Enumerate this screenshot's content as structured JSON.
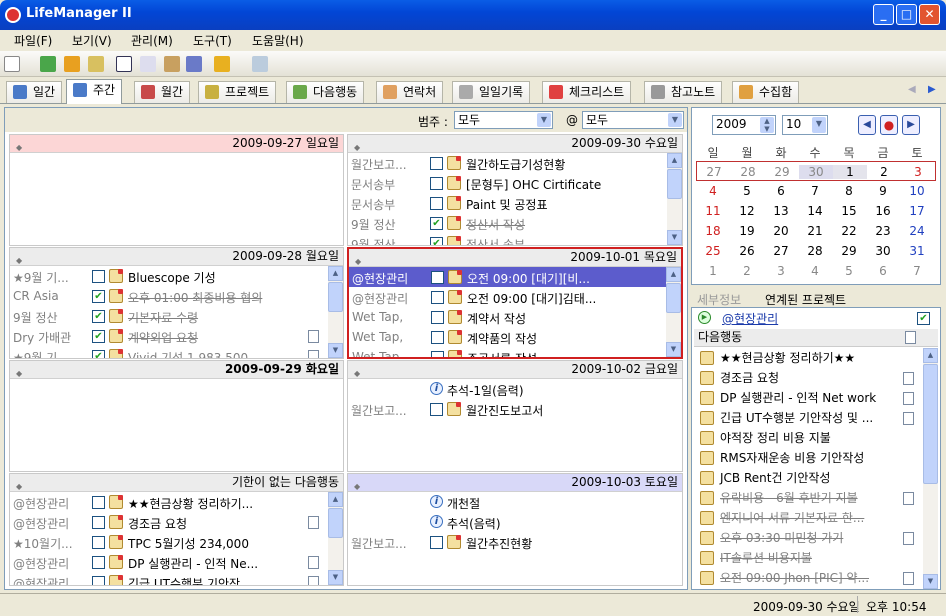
{
  "app": {
    "title": "LifeManager II"
  },
  "menu": [
    "파일(F)",
    "보기(V)",
    "관리(M)",
    "도구(T)",
    "도움말(H)"
  ],
  "tabs": [
    "일간",
    "주간",
    "월간",
    "프로젝트",
    "다음행동",
    "연락처",
    "일일기록",
    "체크리스트",
    "참고노트",
    "수집함"
  ],
  "filter": {
    "label": "범주 :",
    "category": "모두",
    "at": "@",
    "context": "모두"
  },
  "days": {
    "d0927": {
      "title": "2009-09-27 일요일"
    },
    "d0928": {
      "title": "2009-09-28 월요일",
      "items": [
        {
          "cat": "★9월 기...",
          "text": "Bluescope 기성",
          "done": false
        },
        {
          "cat": "CR Asia",
          "text": "오후 01:00 최종비용 협의",
          "done": true
        },
        {
          "cat": "9월 정산",
          "text": "기본자료 수령",
          "done": true
        },
        {
          "cat": "Dry 가배관",
          "text": "계약외업 요청",
          "done": true
        },
        {
          "cat": "★9월 기",
          "text": "Vivid 기성 1,983,500",
          "done": true
        }
      ]
    },
    "d0929": {
      "title": "2009-09-29 화요일"
    },
    "d0930": {
      "title": "2009-09-30 수요일",
      "items": [
        {
          "cat": "월간보고...",
          "text": "월간하도급기성현황",
          "done": false
        },
        {
          "cat": "문서송부",
          "text": "[문형두] OHC Cirtificate",
          "done": false
        },
        {
          "cat": "문서송부",
          "text": "Paint 및 공정표",
          "done": false
        },
        {
          "cat": "9월 정산",
          "text": "정산서 작성",
          "done": true
        },
        {
          "cat": "9월 정산",
          "text": "정산서 송부",
          "done": true
        }
      ]
    },
    "d1001": {
      "title": "2009-10-01 목요일",
      "items": [
        {
          "cat": "@현장관리",
          "text": "오전 09:00 [대기][비...",
          "done": false
        },
        {
          "cat": "@현장관리",
          "text": "오전 09:00 [대기]김태...",
          "done": false
        },
        {
          "cat": "Wet Tap,",
          "text": "계약서 작성",
          "done": false
        },
        {
          "cat": "Wet Tap,",
          "text": "계약품의 작성",
          "done": false
        },
        {
          "cat": "Wet Tap",
          "text": "주공서류 작성",
          "done": false
        }
      ]
    },
    "d1002": {
      "title": "2009-10-02 금요일",
      "info": "추석-1일(음력)",
      "items": [
        {
          "cat": "월간보고...",
          "text": "월간진도보고서",
          "done": false
        }
      ]
    },
    "d1003": {
      "title": "2009-10-03 토요일",
      "info1": "개천절",
      "info2": "추석(음력)",
      "items": [
        {
          "cat": "월간보고...",
          "text": "월간추진현황",
          "done": false
        }
      ]
    },
    "nodate": {
      "title": "기한이 없는 다음행동",
      "items": [
        {
          "cat": "@현장관리",
          "text": "★★현금상황 정리하기..."
        },
        {
          "cat": "@현장관리",
          "text": "경조금 요청"
        },
        {
          "cat": "★10월기...",
          "text": "TPC 5월기성 234,000"
        },
        {
          "cat": "@현장관리",
          "text": "DP 실행관리 - 인적 Ne..."
        },
        {
          "cat": "@현장관리",
          "text": "긴급 UT수행분 기안작..."
        }
      ]
    }
  },
  "calendar": {
    "year": "2009",
    "month": "10",
    "weekdays": [
      "일",
      "월",
      "화",
      "수",
      "목",
      "금",
      "토"
    ],
    "weeks": [
      [
        "27",
        "28",
        "29",
        "30",
        "1",
        "2",
        "3"
      ],
      [
        "4",
        "5",
        "6",
        "7",
        "8",
        "9",
        "10"
      ],
      [
        "11",
        "12",
        "13",
        "14",
        "15",
        "16",
        "17"
      ],
      [
        "18",
        "19",
        "20",
        "21",
        "22",
        "23",
        "24"
      ],
      [
        "25",
        "26",
        "27",
        "28",
        "29",
        "30",
        "31"
      ],
      [
        "1",
        "2",
        "3",
        "4",
        "5",
        "6",
        "7"
      ]
    ]
  },
  "right_tabs": [
    "세부정보",
    "연계된 프로젝트"
  ],
  "project": {
    "name": "@현장관리",
    "list_header": "다음행동",
    "items": [
      {
        "text": "★★현금상황 정리하기★★",
        "done": false
      },
      {
        "text": "경조금 요청",
        "done": false
      },
      {
        "text": "DP 실행관리 - 인적 Net work",
        "done": false
      },
      {
        "text": "긴급 UT수행분 기안작성 및 ...",
        "done": false
      },
      {
        "text": "야적장 정리 비용 지불",
        "done": false
      },
      {
        "text": "RMS자재운송 비용 기안작성",
        "done": false
      },
      {
        "text": "JCB Rent건 기안작성",
        "done": false
      },
      {
        "text": "유락비용 - 6월 후반기 지불",
        "done": true
      },
      {
        "text": "엔지니어 서류 기본자료 한...",
        "done": true
      },
      {
        "text": "오후 03:30 미민청 가기",
        "done": true
      },
      {
        "text": "IT솔루션 비용지불",
        "done": true
      },
      {
        "text": "오전 09:00 Jhon [PIC] 약...",
        "done": true
      }
    ]
  },
  "status": {
    "date": "2009-09-30 수요일",
    "time": "오후 10:54"
  }
}
